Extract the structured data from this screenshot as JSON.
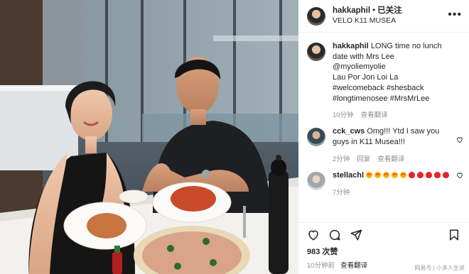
{
  "header": {
    "username": "hakkaphil",
    "separator": "•",
    "follow_status": "已关注",
    "location": "VELO K11 MUSEA",
    "more_icon": "more-icon"
  },
  "comments": [
    {
      "username": "hakkaphil",
      "lines": [
        "LONG time no lunch date with Mrs Lee",
        "@myoliemyolie",
        "Lau Por Jon Loi La",
        "#welcomeback #shesback",
        "#longtimenosee #MrsMrLee"
      ],
      "meta": [
        "10分钟",
        "查看翻译"
      ]
    },
    {
      "username": "cck_cws",
      "text": "Omg!!! Ytd I saw you guys in K11 Musea!!!",
      "meta": [
        "2分钟",
        "回复",
        "查看翻译"
      ]
    },
    {
      "username": "stellachl",
      "emoji": [
        "😍",
        "😍",
        "😍",
        "😍",
        "😍",
        "❤️",
        "❤️",
        "❤️",
        "❤️",
        "❤️"
      ],
      "meta": [
        "7分钟"
      ]
    }
  ],
  "actions": {
    "icons": [
      "heart-icon",
      "comment-icon",
      "share-icon",
      "bookmark-icon"
    ]
  },
  "likes": "983 次赞",
  "timestamp": "10分钟前",
  "translate": "查看翻译",
  "watermark": "网易号 | 小多人生说",
  "colors": {
    "text": "#262626",
    "muted": "#8e8e8e",
    "divider": "#efefef"
  }
}
